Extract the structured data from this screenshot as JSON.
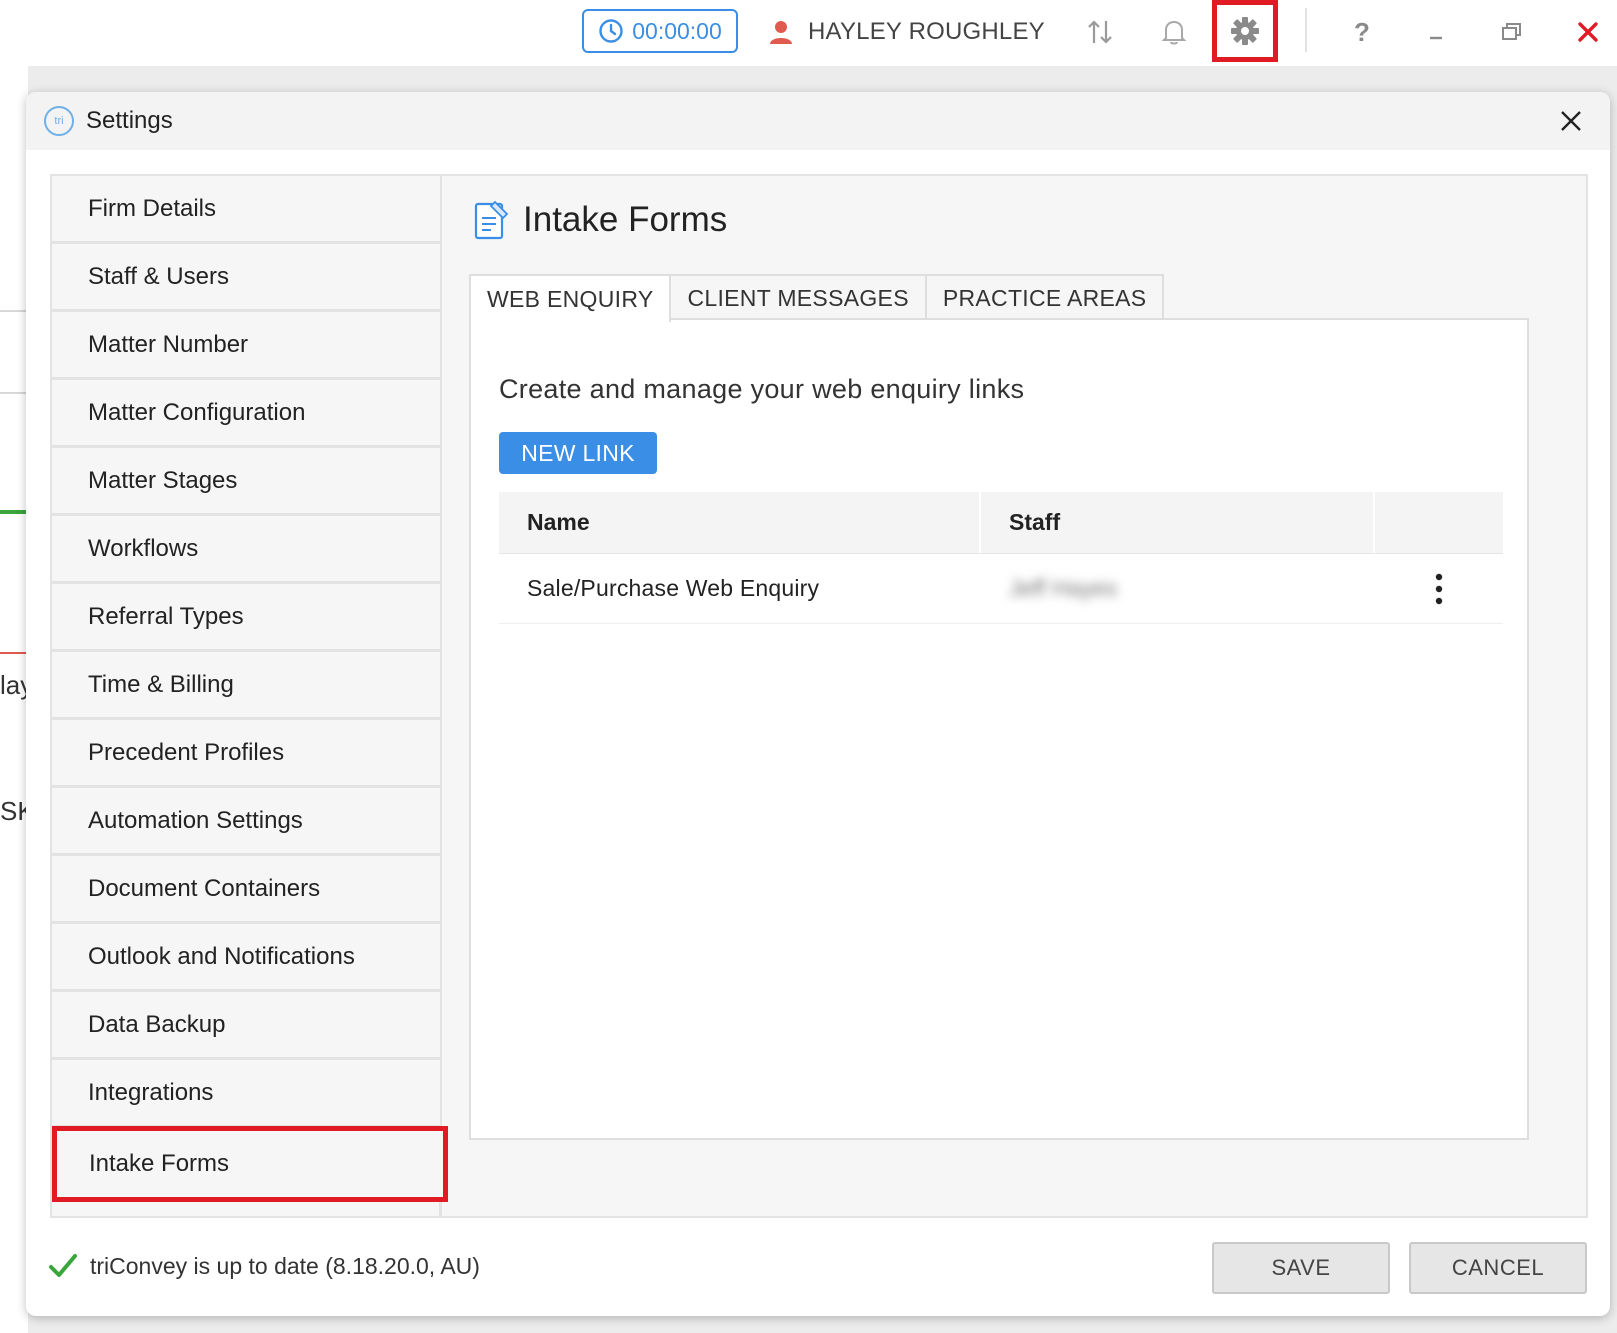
{
  "topbar": {
    "timer": "00:00:00",
    "user_name": "HAYLEY ROUGHLEY",
    "help": "?",
    "icons": [
      "clock-icon",
      "user-icon",
      "sync-arrows-icon",
      "bell-icon",
      "gear-icon",
      "help-icon",
      "minimize-icon",
      "restore-icon",
      "close-icon"
    ]
  },
  "background": {
    "text_1": "lay",
    "text_2": "SK"
  },
  "dialog": {
    "logo": "tri",
    "title": "Settings"
  },
  "sidebar": {
    "items": [
      {
        "label": "Firm Details"
      },
      {
        "label": "Staff & Users"
      },
      {
        "label": "Matter Number"
      },
      {
        "label": "Matter Configuration"
      },
      {
        "label": "Matter Stages"
      },
      {
        "label": "Workflows"
      },
      {
        "label": "Referral Types"
      },
      {
        "label": "Time & Billing"
      },
      {
        "label": "Precedent Profiles"
      },
      {
        "label": "Automation Settings"
      },
      {
        "label": "Document Containers"
      },
      {
        "label": "Outlook and Notifications"
      },
      {
        "label": "Data Backup"
      },
      {
        "label": "Integrations"
      },
      {
        "label": "Intake Forms"
      }
    ],
    "active": "Intake Forms"
  },
  "content": {
    "title": "Intake Forms",
    "tabs": [
      {
        "label": "WEB ENQUIRY"
      },
      {
        "label": "CLIENT MESSAGES"
      },
      {
        "label": "PRACTICE AREAS"
      }
    ],
    "active_tab": "WEB ENQUIRY",
    "description": "Create and manage your web enquiry links",
    "new_link_label": "NEW LINK",
    "table": {
      "columns": [
        "Name",
        "Staff"
      ],
      "rows": [
        {
          "name": "Sale/Purchase Web Enquiry",
          "staff": "Jeff Hayes"
        }
      ]
    }
  },
  "footer": {
    "status": "triConvey is up to date (8.18.20.0, AU)",
    "save_label": "SAVE",
    "cancel_label": "CANCEL"
  },
  "colors": {
    "accent": "#3b8ee6",
    "highlight": "#e01b24",
    "success": "#3aa53a"
  }
}
